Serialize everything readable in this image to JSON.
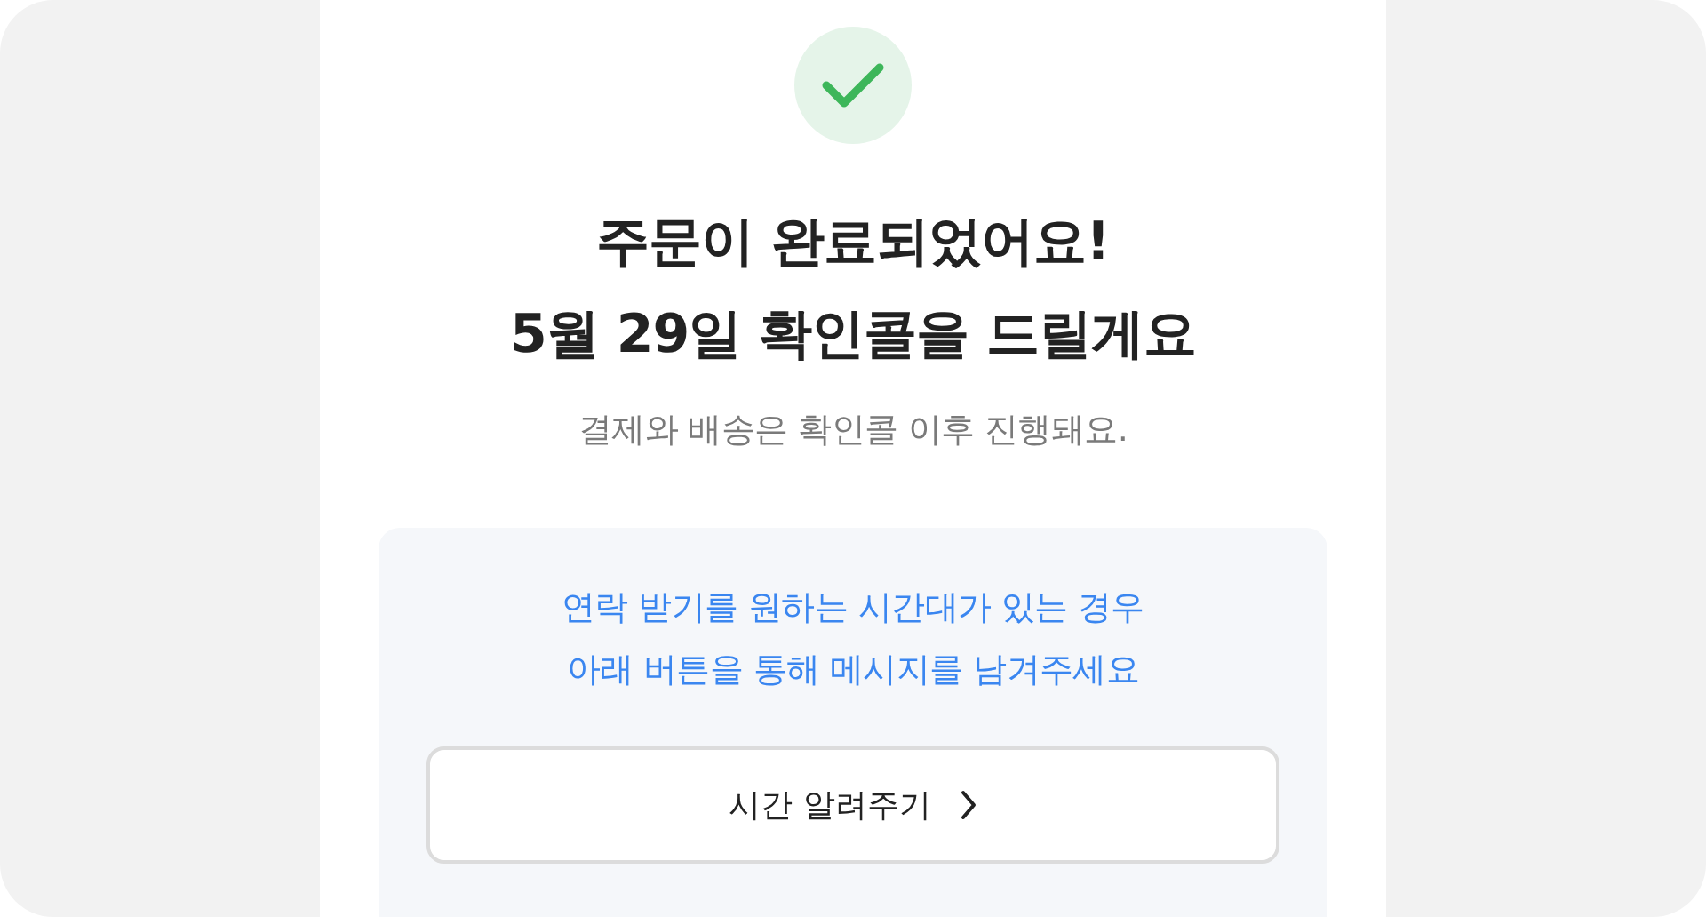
{
  "headline": [
    "주문이 완료되었어요!",
    "5월 29일 확인콜을 드릴게요"
  ],
  "subtitle": "결제와 배송은 확인콜 이후 진행돼요.",
  "notice": {
    "lines": [
      "연락 받기를 원하는 시간대가 있는 경우",
      "아래 버튼을 통해 메시지를 남겨주세요"
    ],
    "button": {
      "label": "시간 알려주기"
    }
  }
}
